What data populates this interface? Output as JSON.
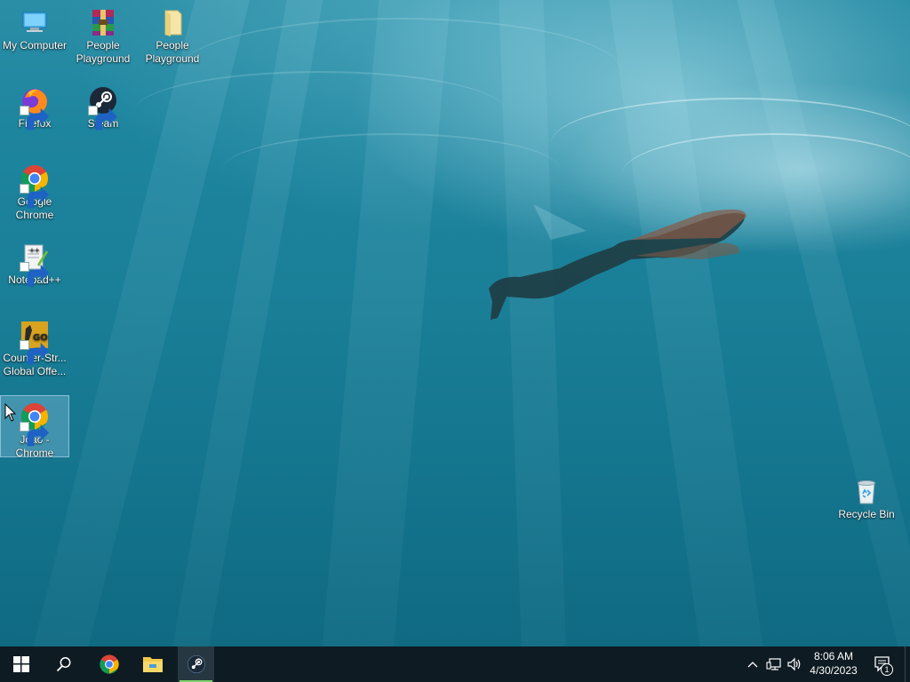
{
  "desktop": {
    "icons": [
      {
        "label": "My Computer",
        "icon": "computer-icon"
      },
      {
        "label": "People Playground",
        "icon": "winrar-archive-icon"
      },
      {
        "label": "People Playground",
        "icon": "folder-icon"
      },
      {
        "label": "Firefox",
        "icon": "firefox-icon"
      },
      {
        "label": "Steam",
        "icon": "steam-icon"
      },
      {
        "label": "Google Chrome",
        "icon": "chrome-icon"
      },
      {
        "label": "Notepad++",
        "icon": "notepadpp-icon"
      },
      {
        "label": "Counter-Str... Global Offe...",
        "icon": "csgo-icon"
      },
      {
        "label": "Joao - Chrome",
        "icon": "chrome-icon",
        "selected": true
      },
      {
        "label": "Recycle Bin",
        "icon": "recycle-bin-icon"
      }
    ]
  },
  "taskbar": {
    "start": "windows-start-icon",
    "search": "search-icon",
    "pinned": [
      {
        "name": "Google Chrome",
        "icon": "chrome-icon"
      },
      {
        "name": "File Explorer",
        "icon": "folder-icon"
      },
      {
        "name": "Steam",
        "icon": "steam-icon",
        "active": true
      }
    ],
    "tray": {
      "icons": [
        "chevron-up-icon",
        "network-icon",
        "volume-icon"
      ],
      "time": "8:06 AM",
      "date": "4/30/2023",
      "notifications_count": "1"
    }
  },
  "colors": {
    "taskbar": "#0e1b22",
    "active_underline": "#7fd36a",
    "water_top": "#2a8ea6",
    "water_bottom": "#0f6a82"
  }
}
